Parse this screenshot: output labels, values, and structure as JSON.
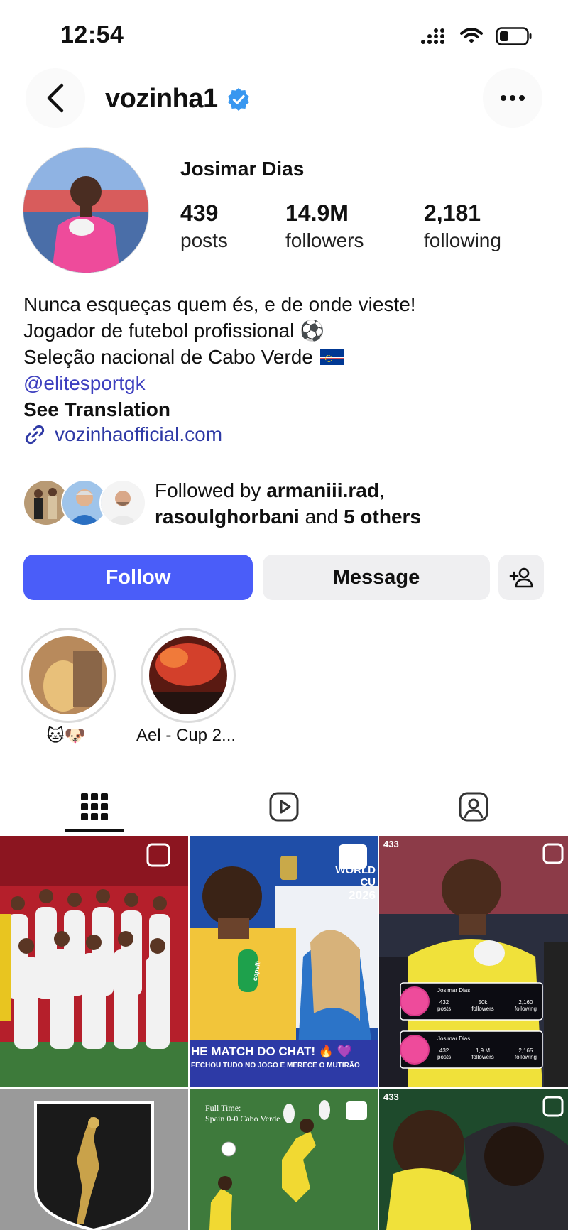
{
  "status_bar": {
    "time": "12:54"
  },
  "header": {
    "username": "vozinha1"
  },
  "profile": {
    "full_name": "Josimar Dias",
    "stats": [
      {
        "value": "439",
        "label": "posts"
      },
      {
        "value": "14.9M",
        "label": "followers"
      },
      {
        "value": "2,181",
        "label": "following"
      }
    ],
    "bio_lines": [
      "Nunca esqueças quem és, e de onde vieste!",
      "Jogador de futebol profissional ⚽",
      "Seleção nacional de Cabo Verde"
    ],
    "mention": "@elitesportgk",
    "see_translation": "See Translation",
    "link": "vozinhaofficial.com"
  },
  "followed_by": {
    "prefix": "Followed by ",
    "user1": "armaniii.rad",
    "comma": ",",
    "user2": "rasoulghorbani",
    "and": " and ",
    "others": "5 others"
  },
  "actions": {
    "follow": "Follow",
    "message": "Message"
  },
  "highlights": [
    {
      "label": "🐱🐶"
    },
    {
      "label": "Ael - Cup 2..."
    }
  ],
  "tiles": {
    "t2": {
      "line1": "WORLD CU",
      "line2": "2026",
      "banner": "HE MATCH DO CHAT! 🔥 💜",
      "sub": "FECHOU TUDO NO JOGO E MERECE O MUTIRÃO",
      "mic": "copelli"
    },
    "t3": {
      "brand": "433",
      "name": "Josimar Dias",
      "c1": [
        "432",
        "posts"
      ],
      "c2": [
        "50k",
        "followers"
      ],
      "c3": [
        "2,160",
        "following"
      ],
      "d1": [
        "432",
        "posts"
      ],
      "d2": [
        "1,9 M",
        "followers"
      ],
      "d3": [
        "2,165",
        "following"
      ]
    },
    "t5": {
      "line1": "Full Time:",
      "line2": "Spain 0-0 Cabo Verde"
    },
    "t6": {
      "brand": "433"
    }
  },
  "colors": {
    "accent": "#4a5df9",
    "verified": "#3897f0",
    "link": "#2f3aa6"
  }
}
